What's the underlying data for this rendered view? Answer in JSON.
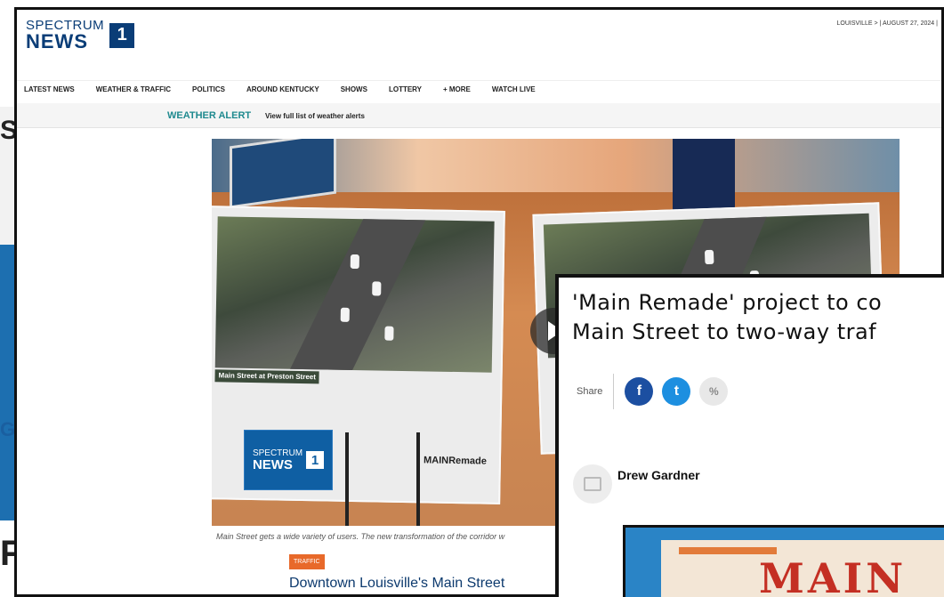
{
  "background": {
    "letters": [
      "S",
      "G",
      "F"
    ]
  },
  "header": {
    "logo_spectrum": "SPECTRUM",
    "logo_news": "NEWS",
    "logo_one": "1",
    "location": "LOUISVILLE",
    "location_chevron": ">",
    "date": "AUGUST 27, 2024",
    "separator": "|"
  },
  "nav": {
    "items": [
      "LATEST NEWS",
      "WEATHER & TRAFFIC",
      "POLITICS",
      "AROUND KENTUCKY",
      "SHOWS",
      "LOTTERY",
      "+ MORE",
      "WATCH LIVE"
    ]
  },
  "alert": {
    "title": "WEATHER ALERT",
    "link": "View full list of weather alerts"
  },
  "hero": {
    "board_left_label": "Main Street at Preston Street",
    "board_brand": "MAINRemade",
    "watermark_spectrum": "SPECTRUM",
    "watermark_news": "NEWS",
    "watermark_one": "1"
  },
  "article": {
    "caption": "Main Street gets a wide variety of users. The new transformation of the corridor w",
    "tag": "TRAFFIC",
    "headline": "Downtown Louisville's Main Street"
  },
  "overlay": {
    "title_line1": "'Main Remade' project to co",
    "title_line2": "Main Street to two-way traf",
    "share_label": "Share",
    "facebook_glyph": "f",
    "twitter_glyph": "t",
    "link_glyph": "%",
    "author": "Drew Gardner",
    "image_text": "MAIN"
  }
}
